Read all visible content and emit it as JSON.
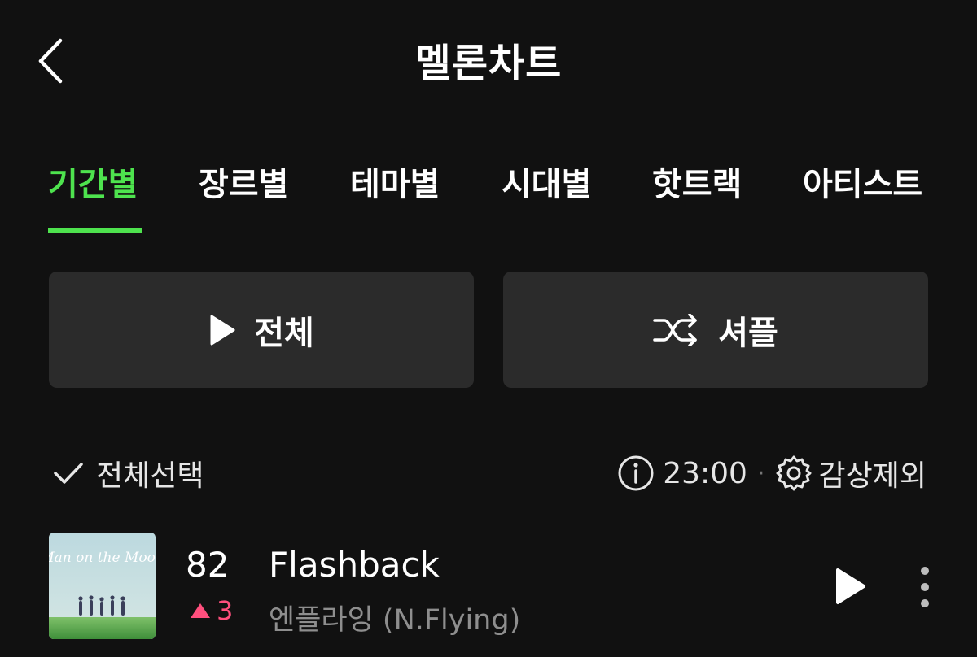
{
  "header": {
    "title": "멜론차트",
    "back_icon": "chevron-left-icon"
  },
  "tabs": [
    {
      "label": "기간별",
      "active": true
    },
    {
      "label": "장르별",
      "active": false
    },
    {
      "label": "테마별",
      "active": false
    },
    {
      "label": "시대별",
      "active": false
    },
    {
      "label": "핫트랙",
      "active": false
    },
    {
      "label": "아티스트",
      "active": false
    }
  ],
  "actions": {
    "play_all_label": "전체",
    "play_all_icon": "play-icon",
    "shuffle_label": "셔플",
    "shuffle_icon": "shuffle-icon"
  },
  "toolbar": {
    "select_all_label": "전체선택",
    "select_all_icon": "check-icon",
    "info_icon": "info-icon",
    "update_time": "23:00",
    "separator": "·",
    "exclude_label": "감상제외",
    "exclude_icon": "gear-icon"
  },
  "chart_list": [
    {
      "rank": "82",
      "rank_change": "3",
      "rank_direction": "up",
      "title": "Flashback",
      "artist": "엔플라잉 (N.Flying)",
      "album_art_text": "Man on the Moon"
    }
  ],
  "colors": {
    "background": "#111111",
    "accent_green": "#4ee34e",
    "rank_up_pink": "#ff4f7d",
    "button_bg": "#2b2b2b",
    "secondary_text": "#8e8e8e"
  }
}
